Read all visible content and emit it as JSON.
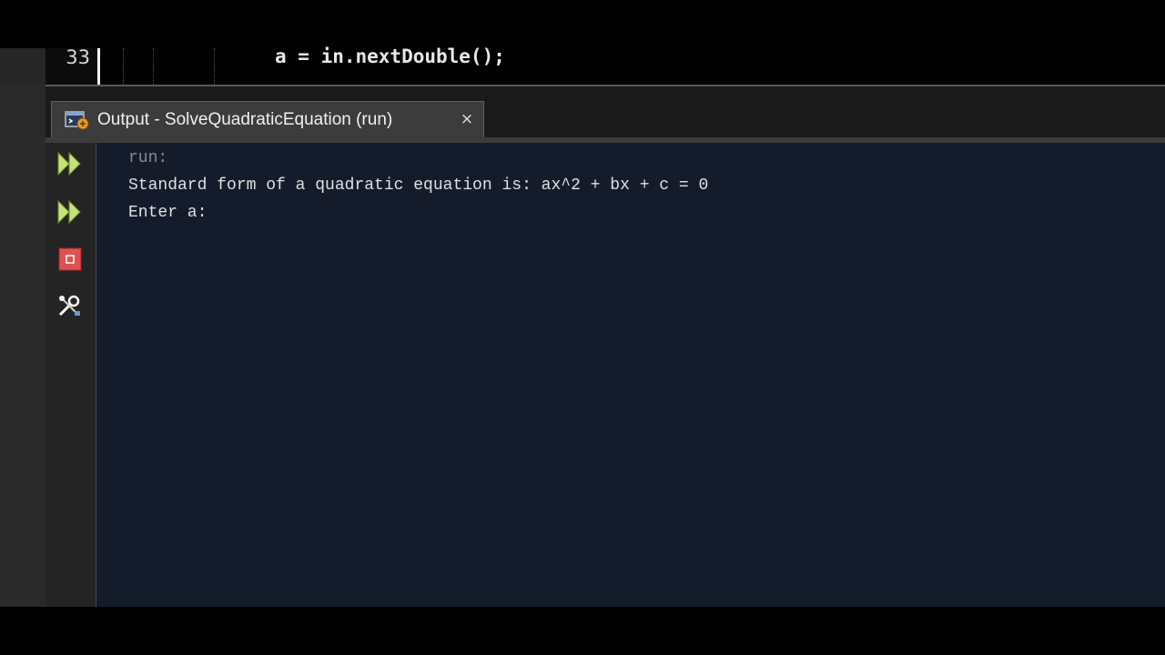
{
  "editor": {
    "line_number": "33",
    "code": "a = in.nextDouble();"
  },
  "output_tab": {
    "title": "Output - SolveQuadraticEquation (run)",
    "close_glyph": "×"
  },
  "toolbar": {
    "items": [
      {
        "name": "rerun-icon",
        "color": "#c8e07a"
      },
      {
        "name": "rerun-with-different-parameters-icon",
        "color": "#c8e07a"
      },
      {
        "name": "stop-icon",
        "color": "#e05050"
      },
      {
        "name": "settings-wrench-icon",
        "color": "#ffffff"
      }
    ]
  },
  "console": {
    "lines": [
      {
        "text": "run:",
        "color": "#8a8a8a"
      },
      {
        "text": "Standard form of a quadratic equation is: ax^2 + bx + c = 0",
        "color": "#e0e0e0"
      },
      {
        "text": "Enter a:",
        "color": "#e0e0e0"
      }
    ],
    "background": "#141c2c"
  }
}
